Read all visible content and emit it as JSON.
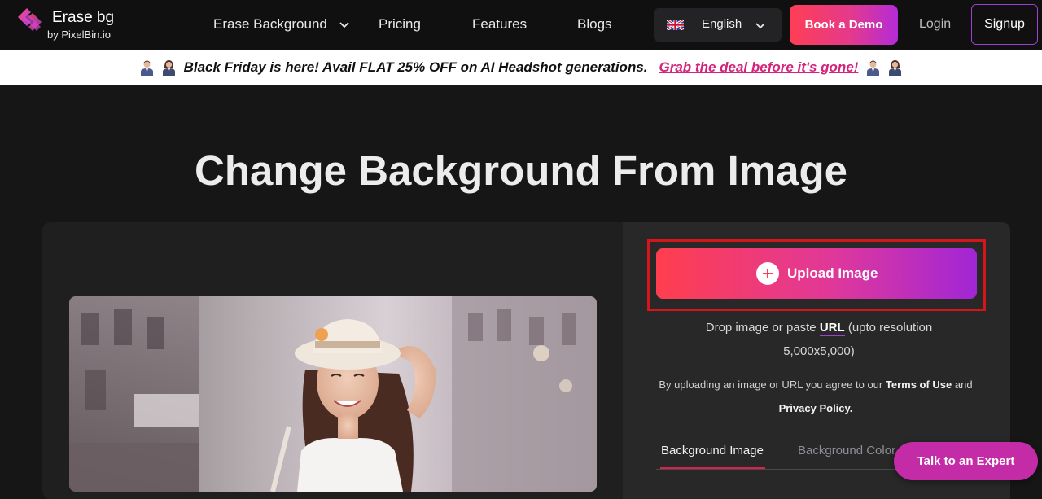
{
  "nav": {
    "logo_title": "Erase bg",
    "logo_subtitle": "by PixelBin.io",
    "links": [
      {
        "label": "Erase Background",
        "has_dropdown": true
      },
      {
        "label": "Pricing",
        "has_dropdown": false
      },
      {
        "label": "Features",
        "has_dropdown": false
      },
      {
        "label": "Blogs",
        "has_dropdown": false
      }
    ],
    "language": {
      "label": "English",
      "flag_icon": "uk-flag-icon"
    },
    "book_demo_label": "Book a Demo",
    "login_label": "Login",
    "signup_label": "Signup"
  },
  "banner": {
    "text": "Black Friday is here! Avail FLAT 25% OFF on AI Headshot generations.",
    "link": "Grab the deal before it's gone!",
    "icons": [
      "man-headshot-icon",
      "woman-headshot-icon"
    ]
  },
  "hero": {
    "title": "Change Background From Image"
  },
  "upload": {
    "button_label": "Upload Image",
    "drop_prefix": "Drop image or paste",
    "drop_url": "URL",
    "drop_suffix": "(upto resolution 5,000x5,000)",
    "terms_prefix": "By uploading an image or URL you agree to our",
    "terms_link": "Terms of Use",
    "terms_and": "and",
    "privacy_link": "Privacy Policy."
  },
  "tabs": [
    {
      "label": "Background Image",
      "active": true
    },
    {
      "label": "Background Color",
      "active": false
    }
  ],
  "expert_button_label": "Talk to an Expert",
  "colors": {
    "accent_red": "#ff3e55",
    "accent_purple": "#a126d6",
    "banner_link": "#d3237a",
    "expert_button": "#c42ba6",
    "upload_outline": "#d4161b"
  }
}
